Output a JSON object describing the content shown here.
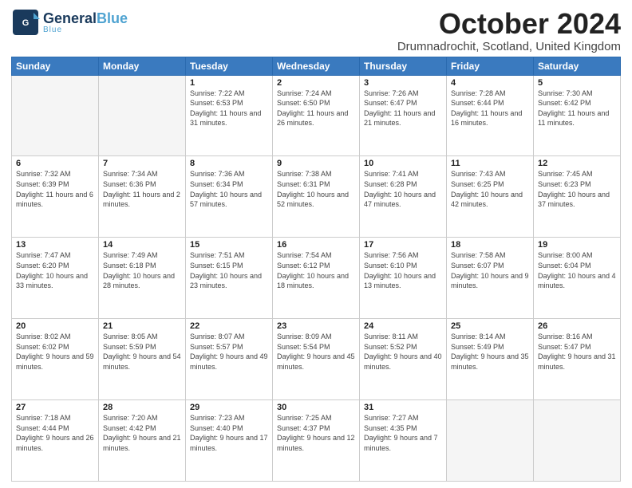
{
  "logo": {
    "line1a": "General",
    "line1b": "Blue",
    "line2": "Blue"
  },
  "header": {
    "month": "October 2024",
    "location": "Drumnadrochit, Scotland, United Kingdom"
  },
  "weekdays": [
    "Sunday",
    "Monday",
    "Tuesday",
    "Wednesday",
    "Thursday",
    "Friday",
    "Saturday"
  ],
  "weeks": [
    [
      {
        "day": "",
        "sunrise": "",
        "sunset": "",
        "daylight": ""
      },
      {
        "day": "",
        "sunrise": "",
        "sunset": "",
        "daylight": ""
      },
      {
        "day": "1",
        "sunrise": "Sunrise: 7:22 AM",
        "sunset": "Sunset: 6:53 PM",
        "daylight": "Daylight: 11 hours and 31 minutes."
      },
      {
        "day": "2",
        "sunrise": "Sunrise: 7:24 AM",
        "sunset": "Sunset: 6:50 PM",
        "daylight": "Daylight: 11 hours and 26 minutes."
      },
      {
        "day": "3",
        "sunrise": "Sunrise: 7:26 AM",
        "sunset": "Sunset: 6:47 PM",
        "daylight": "Daylight: 11 hours and 21 minutes."
      },
      {
        "day": "4",
        "sunrise": "Sunrise: 7:28 AM",
        "sunset": "Sunset: 6:44 PM",
        "daylight": "Daylight: 11 hours and 16 minutes."
      },
      {
        "day": "5",
        "sunrise": "Sunrise: 7:30 AM",
        "sunset": "Sunset: 6:42 PM",
        "daylight": "Daylight: 11 hours and 11 minutes."
      }
    ],
    [
      {
        "day": "6",
        "sunrise": "Sunrise: 7:32 AM",
        "sunset": "Sunset: 6:39 PM",
        "daylight": "Daylight: 11 hours and 6 minutes."
      },
      {
        "day": "7",
        "sunrise": "Sunrise: 7:34 AM",
        "sunset": "Sunset: 6:36 PM",
        "daylight": "Daylight: 11 hours and 2 minutes."
      },
      {
        "day": "8",
        "sunrise": "Sunrise: 7:36 AM",
        "sunset": "Sunset: 6:34 PM",
        "daylight": "Daylight: 10 hours and 57 minutes."
      },
      {
        "day": "9",
        "sunrise": "Sunrise: 7:38 AM",
        "sunset": "Sunset: 6:31 PM",
        "daylight": "Daylight: 10 hours and 52 minutes."
      },
      {
        "day": "10",
        "sunrise": "Sunrise: 7:41 AM",
        "sunset": "Sunset: 6:28 PM",
        "daylight": "Daylight: 10 hours and 47 minutes."
      },
      {
        "day": "11",
        "sunrise": "Sunrise: 7:43 AM",
        "sunset": "Sunset: 6:25 PM",
        "daylight": "Daylight: 10 hours and 42 minutes."
      },
      {
        "day": "12",
        "sunrise": "Sunrise: 7:45 AM",
        "sunset": "Sunset: 6:23 PM",
        "daylight": "Daylight: 10 hours and 37 minutes."
      }
    ],
    [
      {
        "day": "13",
        "sunrise": "Sunrise: 7:47 AM",
        "sunset": "Sunset: 6:20 PM",
        "daylight": "Daylight: 10 hours and 33 minutes."
      },
      {
        "day": "14",
        "sunrise": "Sunrise: 7:49 AM",
        "sunset": "Sunset: 6:18 PM",
        "daylight": "Daylight: 10 hours and 28 minutes."
      },
      {
        "day": "15",
        "sunrise": "Sunrise: 7:51 AM",
        "sunset": "Sunset: 6:15 PM",
        "daylight": "Daylight: 10 hours and 23 minutes."
      },
      {
        "day": "16",
        "sunrise": "Sunrise: 7:54 AM",
        "sunset": "Sunset: 6:12 PM",
        "daylight": "Daylight: 10 hours and 18 minutes."
      },
      {
        "day": "17",
        "sunrise": "Sunrise: 7:56 AM",
        "sunset": "Sunset: 6:10 PM",
        "daylight": "Daylight: 10 hours and 13 minutes."
      },
      {
        "day": "18",
        "sunrise": "Sunrise: 7:58 AM",
        "sunset": "Sunset: 6:07 PM",
        "daylight": "Daylight: 10 hours and 9 minutes."
      },
      {
        "day": "19",
        "sunrise": "Sunrise: 8:00 AM",
        "sunset": "Sunset: 6:04 PM",
        "daylight": "Daylight: 10 hours and 4 minutes."
      }
    ],
    [
      {
        "day": "20",
        "sunrise": "Sunrise: 8:02 AM",
        "sunset": "Sunset: 6:02 PM",
        "daylight": "Daylight: 9 hours and 59 minutes."
      },
      {
        "day": "21",
        "sunrise": "Sunrise: 8:05 AM",
        "sunset": "Sunset: 5:59 PM",
        "daylight": "Daylight: 9 hours and 54 minutes."
      },
      {
        "day": "22",
        "sunrise": "Sunrise: 8:07 AM",
        "sunset": "Sunset: 5:57 PM",
        "daylight": "Daylight: 9 hours and 49 minutes."
      },
      {
        "day": "23",
        "sunrise": "Sunrise: 8:09 AM",
        "sunset": "Sunset: 5:54 PM",
        "daylight": "Daylight: 9 hours and 45 minutes."
      },
      {
        "day": "24",
        "sunrise": "Sunrise: 8:11 AM",
        "sunset": "Sunset: 5:52 PM",
        "daylight": "Daylight: 9 hours and 40 minutes."
      },
      {
        "day": "25",
        "sunrise": "Sunrise: 8:14 AM",
        "sunset": "Sunset: 5:49 PM",
        "daylight": "Daylight: 9 hours and 35 minutes."
      },
      {
        "day": "26",
        "sunrise": "Sunrise: 8:16 AM",
        "sunset": "Sunset: 5:47 PM",
        "daylight": "Daylight: 9 hours and 31 minutes."
      }
    ],
    [
      {
        "day": "27",
        "sunrise": "Sunrise: 7:18 AM",
        "sunset": "Sunset: 4:44 PM",
        "daylight": "Daylight: 9 hours and 26 minutes."
      },
      {
        "day": "28",
        "sunrise": "Sunrise: 7:20 AM",
        "sunset": "Sunset: 4:42 PM",
        "daylight": "Daylight: 9 hours and 21 minutes."
      },
      {
        "day": "29",
        "sunrise": "Sunrise: 7:23 AM",
        "sunset": "Sunset: 4:40 PM",
        "daylight": "Daylight: 9 hours and 17 minutes."
      },
      {
        "day": "30",
        "sunrise": "Sunrise: 7:25 AM",
        "sunset": "Sunset: 4:37 PM",
        "daylight": "Daylight: 9 hours and 12 minutes."
      },
      {
        "day": "31",
        "sunrise": "Sunrise: 7:27 AM",
        "sunset": "Sunset: 4:35 PM",
        "daylight": "Daylight: 9 hours and 7 minutes."
      },
      {
        "day": "",
        "sunrise": "",
        "sunset": "",
        "daylight": ""
      },
      {
        "day": "",
        "sunrise": "",
        "sunset": "",
        "daylight": ""
      }
    ]
  ]
}
